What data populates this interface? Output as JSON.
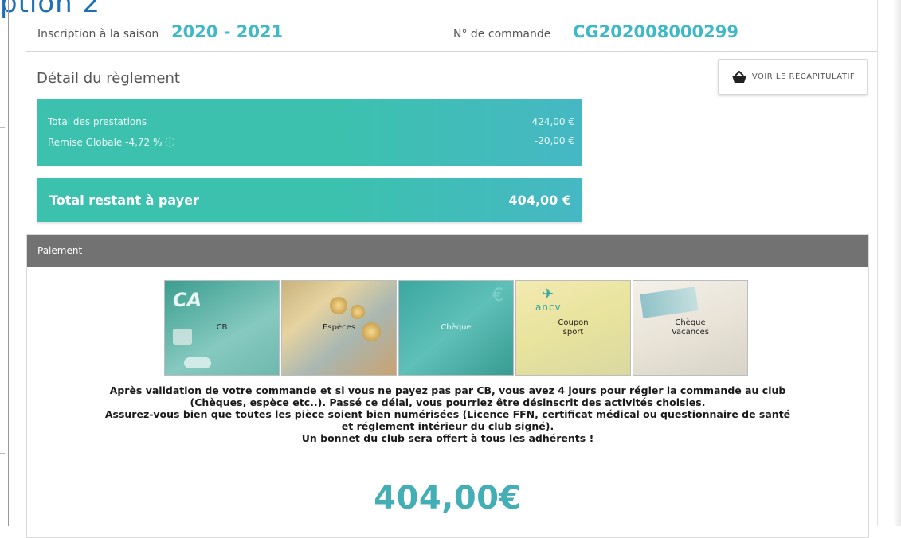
{
  "header_fragment": "ption 2",
  "season": {
    "label": "Inscription à la saison",
    "value": "2020 - 2021"
  },
  "order": {
    "label": "N° de commande",
    "value": "CG202008000299"
  },
  "detail": {
    "title": "Détail du règlement",
    "recap_button": "VOIR LE RÉCAPITULATIF",
    "rows": [
      {
        "label": "Total des prestations",
        "value": "424,00 €"
      },
      {
        "label": "Remise Globale -4,72 % ⓘ",
        "value": "-20,00 €"
      }
    ],
    "remaining": {
      "label": "Total restant à payer",
      "value": "404,00 €"
    }
  },
  "payment": {
    "heading": "Paiement",
    "methods": [
      {
        "label": "CB",
        "icon": "credit-card-icon"
      },
      {
        "label": "Espèces",
        "icon": "cash-icon"
      },
      {
        "label": "Chèque",
        "icon": "cheque-icon"
      },
      {
        "label": "Coupon\nsport",
        "icon": "coupon-icon"
      },
      {
        "label": "Chèque\nVacances",
        "icon": "vacation-cheque-icon"
      }
    ],
    "notice_lines": [
      "Après validation de votre commande et si vous ne payez pas par CB, vous avez 4 jours pour régler la commande au club",
      "(Chèques, espèce etc..). Passé ce délai, vous pourriez être désinscrit des activités choisies.",
      "Assurez-vous bien que toutes les pièce soient bien numérisées (Licence FFN, certificat médical ou questionnaire de santé",
      "et réglement intérieur du club signé).",
      "Un bonnet du club sera offert à tous les adhérents !"
    ],
    "amount": "404,00€"
  },
  "colors": {
    "accent": "#3cc1ae",
    "brand_blue": "#3fb9c6",
    "panel_head": "#727272"
  }
}
